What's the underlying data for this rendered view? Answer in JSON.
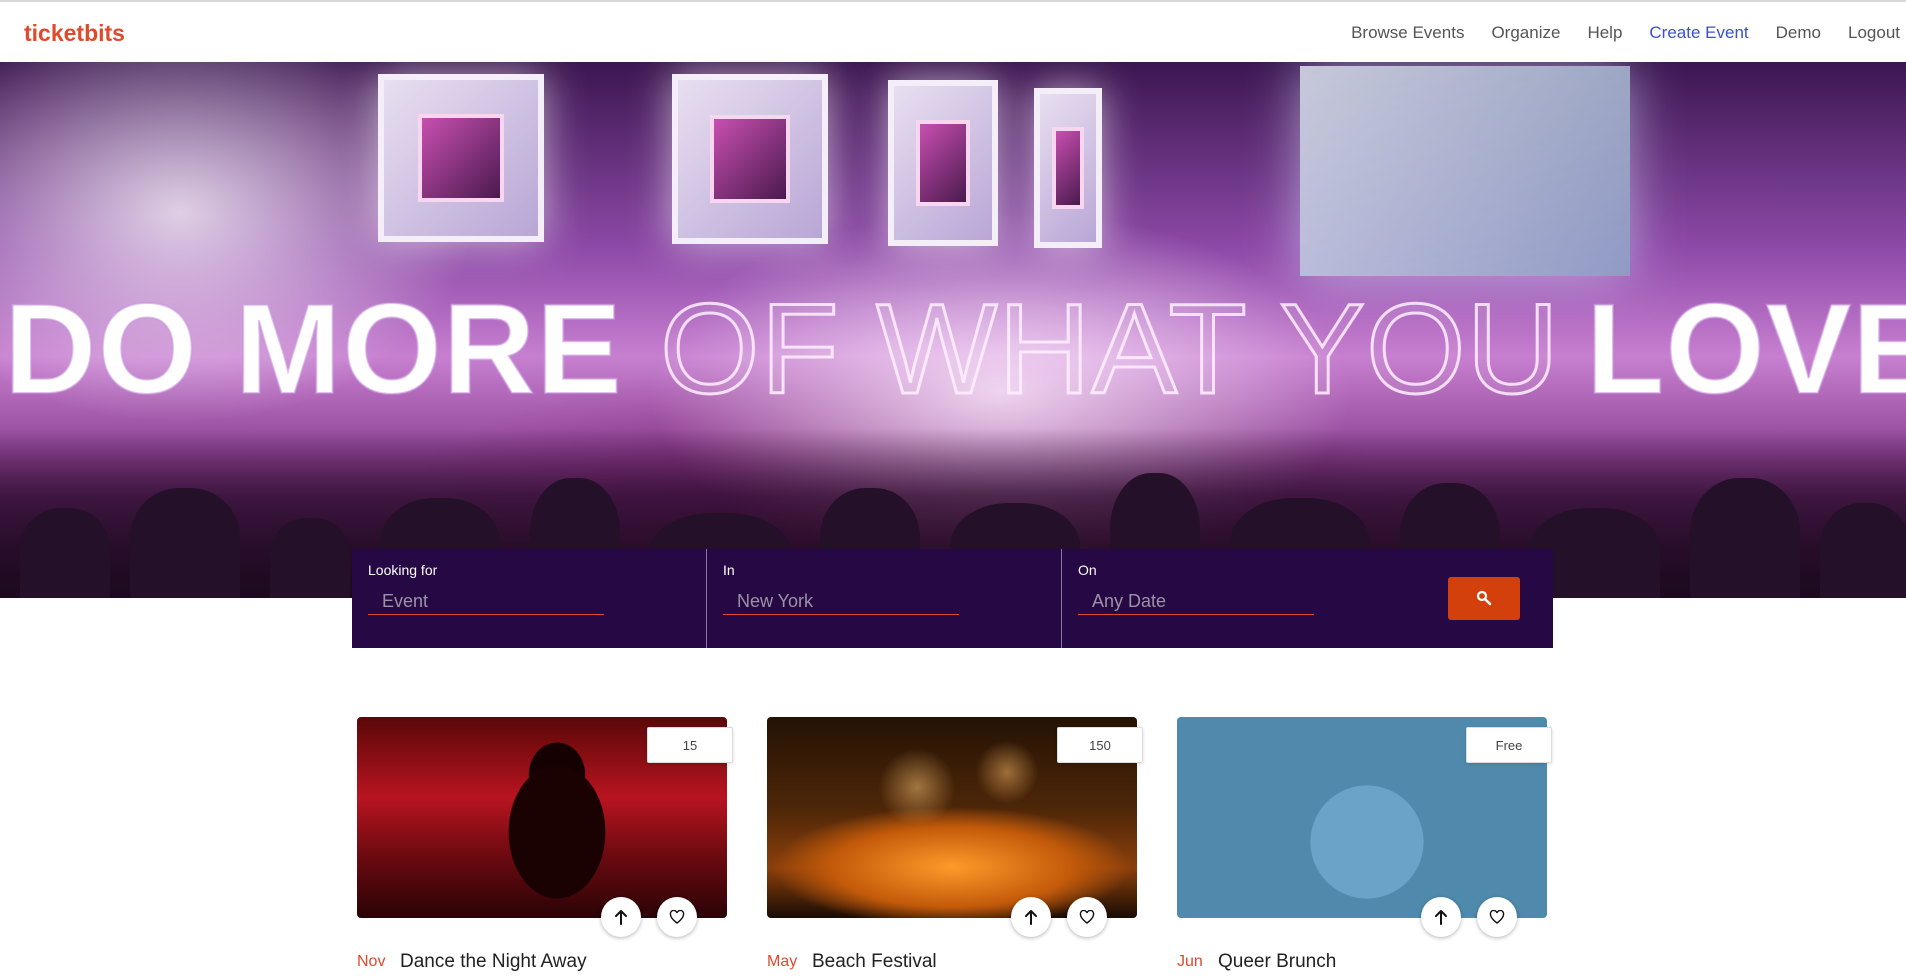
{
  "brand": {
    "name": "ticketbits"
  },
  "nav": {
    "items": [
      {
        "label": "Browse Events"
      },
      {
        "label": "Organize"
      },
      {
        "label": "Help"
      },
      {
        "label": "Create Event"
      },
      {
        "label": "Demo"
      },
      {
        "label": "Logout"
      }
    ]
  },
  "hero": {
    "headline_1": "DO MORE",
    "headline_2": "OF WHAT YOU",
    "headline_3": "LOVE"
  },
  "search": {
    "looking_for_label": "Looking for",
    "looking_for_placeholder": "Event",
    "in_label": "In",
    "in_placeholder": "New York",
    "on_label": "On",
    "on_placeholder": "Any Date",
    "button_icon": "search-icon"
  },
  "events": [
    {
      "price": "15",
      "month": "Nov",
      "title": "Dance the Night Away"
    },
    {
      "price": "150",
      "month": "May",
      "title": "Beach Festival"
    },
    {
      "price": "Free",
      "month": "Jun",
      "title": "Queer Brunch"
    }
  ],
  "colors": {
    "brand": "#e0492c",
    "accent_link": "#3a4fd6",
    "search_bg": "#260844",
    "search_button": "#d4400c"
  }
}
